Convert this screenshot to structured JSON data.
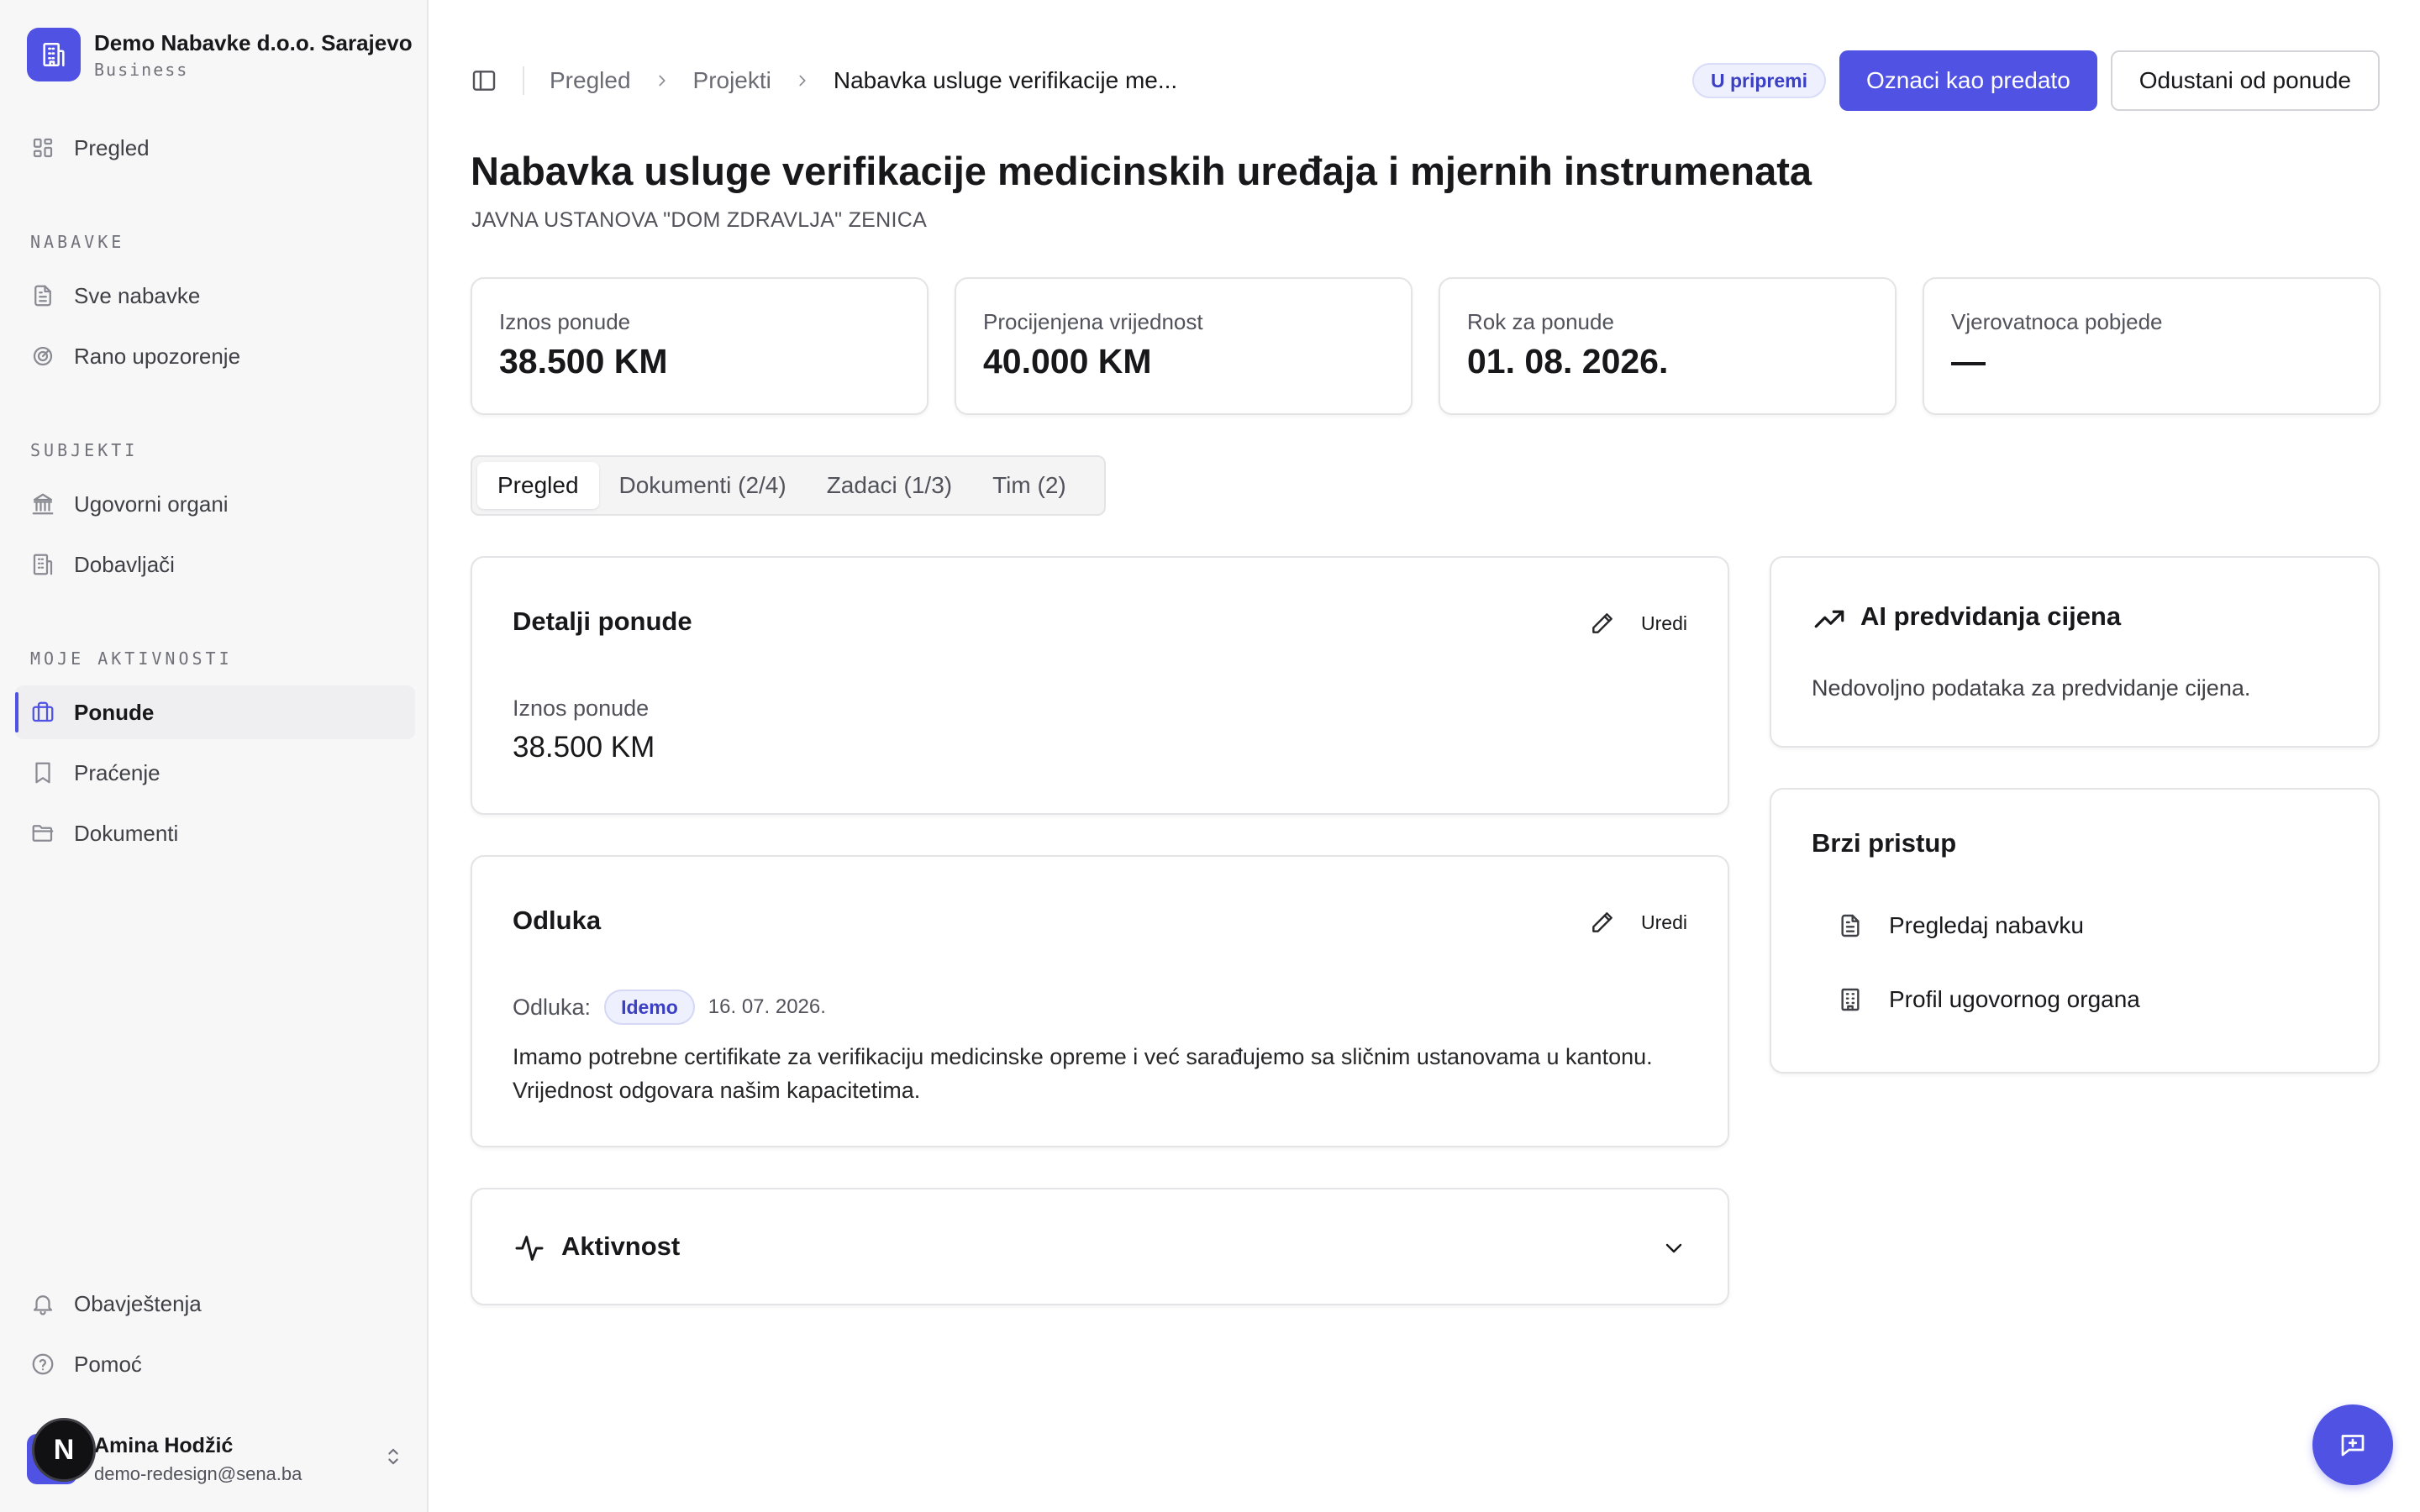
{
  "org": {
    "name": "Demo Nabavke d.o.o. Sarajevo",
    "plan": "Business"
  },
  "nav": {
    "overview": "Pregled",
    "section_procurements": "NABAVKE",
    "all_procurements": "Sve nabavke",
    "early_warning": "Rano upozorenje",
    "section_subjects": "SUBJEKTI",
    "contracting_authorities": "Ugovorni organi",
    "suppliers": "Dobavljači",
    "section_activities": "MOJE AKTIVNOSTI",
    "bids": "Ponude",
    "tracking": "Praćenje",
    "documents": "Dokumenti",
    "notifications": "Obavještenja",
    "help": "Pomoć"
  },
  "user": {
    "name": "Amina Hodžić",
    "email": "demo-redesign@sena.ba",
    "badge": "N"
  },
  "breadcrumb": {
    "root": "Pregled",
    "projects": "Projekti",
    "current": "Nabavka usluge verifikacije me..."
  },
  "actions": {
    "status": "U pripremi",
    "submit": "Oznaci kao predato",
    "withdraw": "Odustani od ponude"
  },
  "page": {
    "title": "Nabavka usluge verifikacije medicinskih uređaja i mjernih instrumenata",
    "subtitle": "JAVNA USTANOVA \"DOM ZDRAVLJA\" ZENICA"
  },
  "stats": [
    {
      "label": "Iznos ponude",
      "value": "38.500 KM"
    },
    {
      "label": "Procijenjena vrijednost",
      "value": "40.000 KM"
    },
    {
      "label": "Rok za ponude",
      "value": "01. 08. 2026."
    },
    {
      "label": "Vjerovatnoca pobjede",
      "value": "—"
    }
  ],
  "tabs": [
    "Pregled",
    "Dokumenti (2/4)",
    "Zadaci (1/3)",
    "Tim (2)"
  ],
  "details": {
    "title": "Detalji ponude",
    "edit": "Uredi",
    "amount_label": "Iznos ponude",
    "amount_value": "38.500 KM"
  },
  "decision": {
    "title": "Odluka",
    "edit": "Uredi",
    "label": "Odluka:",
    "value": "Idemo",
    "date": "16. 07. 2026.",
    "text": "Imamo potrebne certifikate za verifikaciju medicinske opreme i već sarađujemo sa sličnim ustanovama u kantonu. Vrijednost odgovara našim kapacitetima."
  },
  "activity": {
    "title": "Aktivnost"
  },
  "ai": {
    "title": "AI predvidanja cijena",
    "text": "Nedovoljno podataka za predvidanje cijena."
  },
  "quick": {
    "title": "Brzi pristup",
    "view_procurement": "Pregledaj nabavku",
    "authority_profile": "Profil ugovornog organa"
  },
  "colors": {
    "accent": "#4f52e3",
    "sidebar_bg": "#f7f7f8",
    "badge_bg": "#eef0fe"
  },
  "icons": {
    "org": "building-icon",
    "overview": "grid-icon",
    "all": "file-icon",
    "warning": "radar-icon",
    "authorities": "landmark-icon",
    "suppliers": "building-icon",
    "bids": "briefcase-icon",
    "tracking": "bookmark-icon",
    "documents": "folder-icon",
    "notifications": "bell-icon",
    "help": "help-circle-icon",
    "edit": "pencil-icon",
    "activity": "pulse-icon",
    "trend": "trend-up-icon",
    "chat": "message-plus-icon"
  }
}
